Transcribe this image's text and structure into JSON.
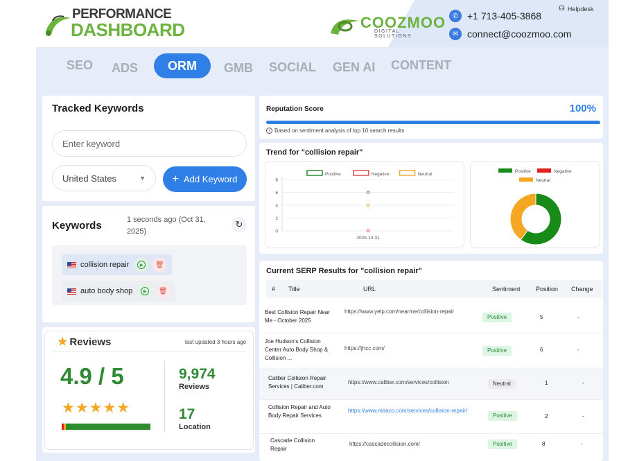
{
  "header": {
    "logo_top": "PERFORMANCE",
    "logo_bottom": "DASHBOARD",
    "brand_name": "COOZMOO",
    "brand_sub": "DIGITAL SOLUTIONS",
    "phone": "+1 713-405-3868",
    "email": "connect@coozmoo.com",
    "helpdesk": "Helpdesk"
  },
  "tabs": [
    "SEO",
    "ADS",
    "ORM",
    "GMB",
    "SOCIAL",
    "GEN AI",
    "CONTENT"
  ],
  "active_tab": "ORM",
  "tracked_keywords": {
    "title": "Tracked Keywords",
    "input_placeholder": "Enter keyword",
    "country": "United States",
    "add_button": "Add Keyword"
  },
  "keywords": {
    "title": "Keywords",
    "updated": "1 seconds ago (Oct 31, 2025)",
    "items": [
      "collision repair",
      "auto body shop"
    ]
  },
  "reviews": {
    "title": "Reviews",
    "updated": "last updated 3 hours ago",
    "rating": "4.9 / 5",
    "stars": "★★★★★",
    "reviews_count": "9,974",
    "reviews_label": "Reviews",
    "location_count": "17",
    "location_label": "Location"
  },
  "reputation": {
    "title": "Reputation Score",
    "value": "100%",
    "fill": 1.0,
    "note": "Based on sentiment analysis of top 10 search results"
  },
  "trend": {
    "title": "Trend for \"collision repair\""
  },
  "chart_data": [
    {
      "type": "scatter",
      "x": [
        "2025-10-31"
      ],
      "series": [
        {
          "name": "Positive",
          "values": [
            6
          ],
          "color": "#2e8b2e"
        },
        {
          "name": "Negative",
          "values": [
            0
          ],
          "color": "#d9534f"
        },
        {
          "name": "Neutral",
          "values": [
            4
          ],
          "color": "#f0a830"
        }
      ],
      "yticks": [
        0,
        2,
        4,
        6,
        8
      ],
      "ylim": [
        0,
        8
      ],
      "legend": "top"
    },
    {
      "type": "pie",
      "categories": [
        "Positive",
        "Negative",
        "Neutral"
      ],
      "values": [
        6,
        0,
        4
      ],
      "colors": [
        "#178a17",
        "#e0201b",
        "#f5a623"
      ],
      "legend": "top"
    }
  ],
  "serp": {
    "title": "Current SERP Results for \"collision repair\"",
    "headers": [
      "#",
      "Title",
      "URL",
      "Sentiment",
      "Position",
      "Change"
    ],
    "rows": [
      {
        "title": "Best Collision Repair Near Me - October 2025",
        "url": "https://www.yelp.com/nearme/collision-repair",
        "sentiment": "Positive",
        "position": "5",
        "change": "-"
      },
      {
        "title": "Joe Hudson's Collision Center Auto Body Shop & Collision ...",
        "url": "https://jhcc.com/",
        "sentiment": "Positive",
        "position": "6",
        "change": "-"
      },
      {
        "title": "Caliber Collision Repair Services | Caliber.com",
        "url": "https://www.caliber.com/services/collision",
        "sentiment": "Neutral",
        "position": "1",
        "change": "-"
      },
      {
        "title": "Collision Repair and Auto Body Repair Services",
        "url": "https://www.maaco.com/services/collision-repair/",
        "sentiment": "Positive",
        "position": "2",
        "change": "-"
      },
      {
        "title": "Cascade Collision Repair",
        "url": "https://cascadecollision.com/",
        "sentiment": "Positive",
        "position": "8",
        "change": "-"
      }
    ]
  }
}
